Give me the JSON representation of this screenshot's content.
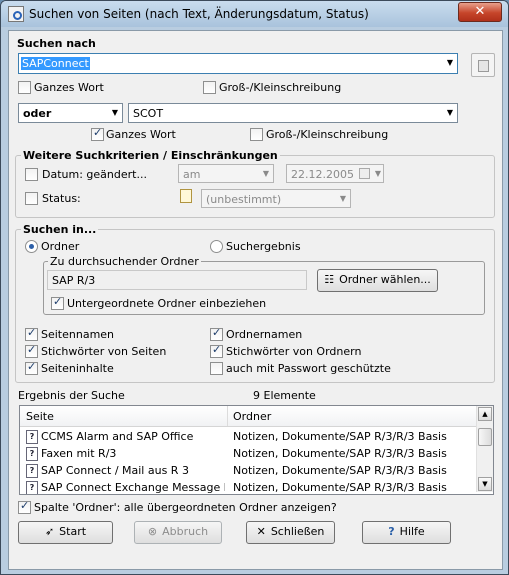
{
  "window": {
    "title": "Suchen von Seiten (nach Text, Änderungsdatum, Status)",
    "close_glyph": "✕"
  },
  "search": {
    "heading": "Suchen nach",
    "term1": "SAPConnect",
    "whole_word_1": "Ganzes Wort",
    "whole_word_1_checked": false,
    "case_1": "Groß-/Kleinschreibung",
    "case_1_checked": false,
    "operator": "oder",
    "term2": "SCOT",
    "whole_word_2": "Ganzes Wort",
    "whole_word_2_checked": true,
    "case_2": "Groß-/Kleinschreibung",
    "case_2_checked": false
  },
  "criteria": {
    "heading": "Weitere Suchkriterien / Einschränkungen",
    "date_label": "Datum: geändert...",
    "date_checked": false,
    "date_op": "am",
    "date_value": "22.12.2005",
    "status_label": "Status:",
    "status_checked": false,
    "status_value": "(unbestimmt)"
  },
  "search_in": {
    "heading": "Suchen in...",
    "folder_radio": "Ordner",
    "result_radio": "Suchergebnis",
    "selected": "Ordner",
    "folder_group": "Zu durchsuchender Ordner",
    "folder_value": "SAP R/3",
    "choose_folder_btn": "Ordner wählen...",
    "include_sub": "Untergeordnete Ordner einbeziehen",
    "include_sub_checked": true,
    "options": [
      {
        "label": "Seitennamen",
        "checked": true
      },
      {
        "label": "Ordnernamen",
        "checked": true
      },
      {
        "label": "Stichwörter von Seiten",
        "checked": true
      },
      {
        "label": "Stichwörter von Ordnern",
        "checked": true
      },
      {
        "label": "Seiteninhalte",
        "checked": true
      },
      {
        "label": "auch mit Passwort geschützte",
        "checked": false
      }
    ]
  },
  "results": {
    "heading": "Ergebnis der Suche",
    "count": "9 Elemente",
    "columns": [
      "Seite",
      "Ordner"
    ],
    "rows": [
      {
        "page": "CCMS Alarm and SAP Office",
        "folder": "Notizen, Dokumente/SAP R/3/R/3 Basis"
      },
      {
        "page": "Faxen mit R/3",
        "folder": "Notizen, Dokumente/SAP R/3/R/3 Basis"
      },
      {
        "page": "SAP Connect / Mail aus R 3",
        "folder": "Notizen, Dokumente/SAP R/3/R/3 Basis"
      },
      {
        "page": "SAP Connect Exchange Message h",
        "folder": "Notizen, Dokumente/SAP R/3/R/3 Basis"
      }
    ],
    "show_parent": "Spalte 'Ordner': alle übergeordneten Ordner anzeigen?",
    "show_parent_checked": true
  },
  "buttons": {
    "start": "Start",
    "cancel": "Abbruch",
    "close": "Schließen",
    "help": "Hilfe"
  }
}
